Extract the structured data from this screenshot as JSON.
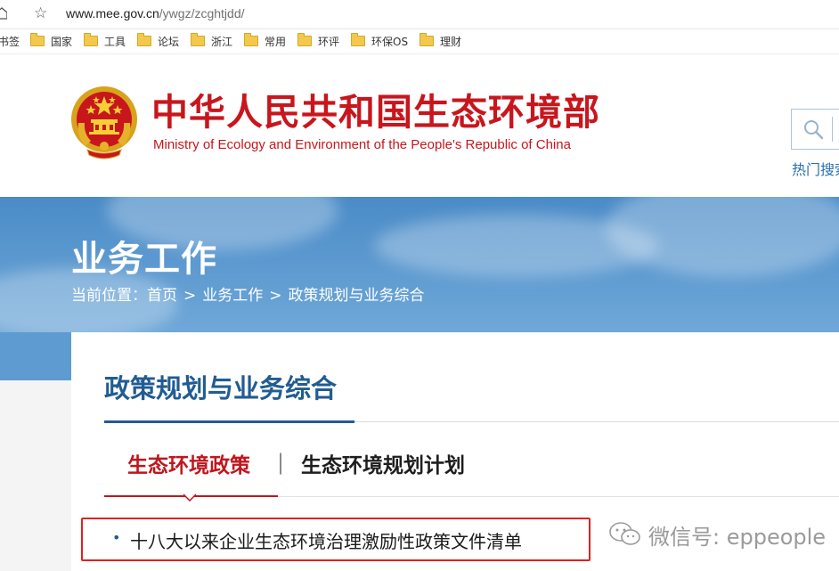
{
  "browser": {
    "url_host": "www.mee.gov.cn",
    "url_path": "/ywgz/zcghtjdd/",
    "bookmarks": [
      {
        "label": "书签"
      },
      {
        "label": "国家"
      },
      {
        "label": "工具"
      },
      {
        "label": "论坛"
      },
      {
        "label": "浙江"
      },
      {
        "label": "常用"
      },
      {
        "label": "环评"
      },
      {
        "label": "环保OS"
      },
      {
        "label": "理财"
      }
    ]
  },
  "header": {
    "title": "中华人民共和国生态环境部",
    "subtitle": "Ministry of Ecology and Environment of the People's Republic of China",
    "hot_search": "热门搜索"
  },
  "banner": {
    "title": "业务工作",
    "breadcrumb": {
      "prefix": "当前位置：",
      "items": [
        "首页",
        "业务工作",
        "政策规划与业务综合"
      ],
      "separator": ">"
    }
  },
  "main": {
    "section_title": "政策规划与业务综合",
    "tabs": [
      {
        "label": "生态环境政策",
        "active": true
      },
      {
        "label": "生态环境规划计划",
        "active": false
      }
    ],
    "tab_separator": "|",
    "list": [
      {
        "bullet": "•",
        "text": "十八大以来企业生态环境治理激励性政策文件清单"
      }
    ]
  },
  "watermark": {
    "text": "微信号: eppeople"
  },
  "colors": {
    "brand_red": "#c8161d",
    "nav_blue": "#215c92",
    "banner_blue": "#5b98cf",
    "highlight_red": "#e02020"
  }
}
